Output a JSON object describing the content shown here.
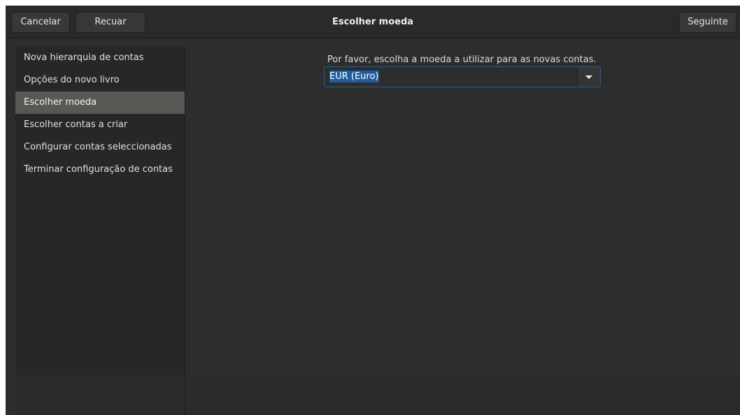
{
  "header": {
    "title": "Escolher moeda",
    "cancel_label": "Cancelar",
    "back_label": "Recuar",
    "next_label": "Seguinte"
  },
  "sidebar": {
    "items": [
      {
        "label": "Nova hierarquia de contas",
        "selected": false
      },
      {
        "label": "Opções do novo livro",
        "selected": false
      },
      {
        "label": "Escolher moeda",
        "selected": true
      },
      {
        "label": "Escolher contas a criar",
        "selected": false
      },
      {
        "label": "Configurar contas seleccionadas",
        "selected": false
      },
      {
        "label": "Terminar configuração de contas",
        "selected": false
      }
    ]
  },
  "main": {
    "prompt": "Por favor, escolha a moeda a utilizar para as novas contas.",
    "currency_value": "EUR (Euro)"
  },
  "colors": {
    "window_bg": "#2d2d2d",
    "selection": "#215d9c",
    "sidebar_selected": "#585855"
  }
}
